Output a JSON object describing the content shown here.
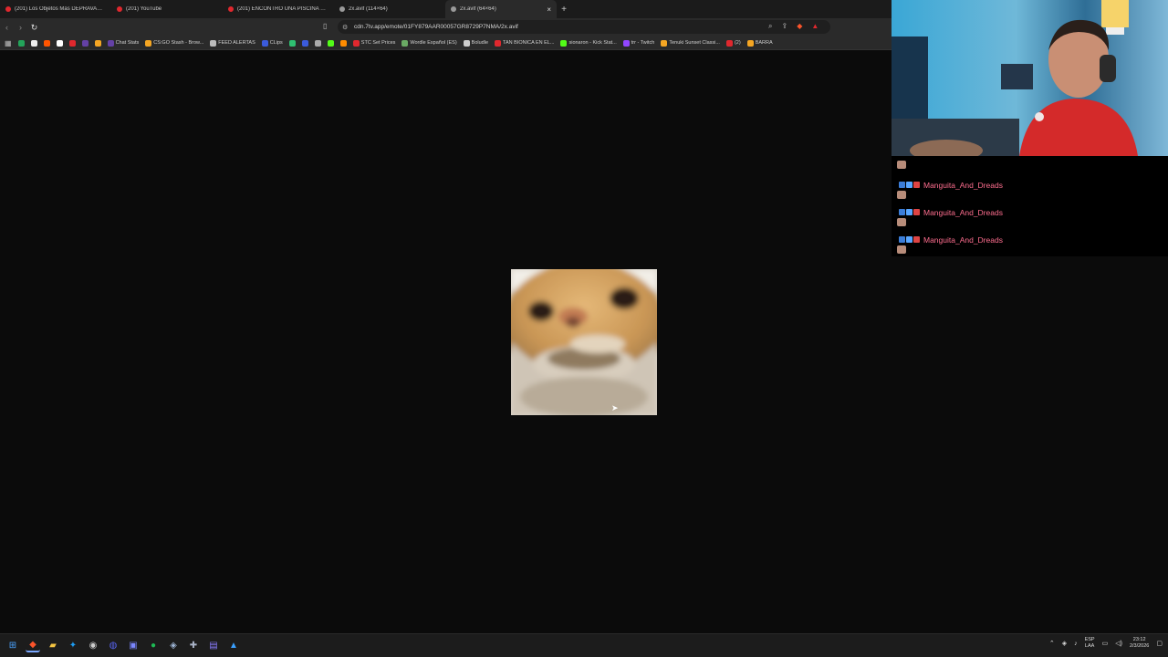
{
  "tabs": [
    {
      "label": "(201) Los Objetos Más DEPRAVADOS",
      "color": "#e0282e",
      "active": false
    },
    {
      "label": "(201) YouTube",
      "color": "#e0282e",
      "active": false
    },
    {
      "label": "(201) ENCONTRÓ UNA PISCINA CON",
      "color": "#e0282e",
      "active": false
    },
    {
      "label": "2x.avif (114×64)",
      "color": "#9a9a9a",
      "active": false
    },
    {
      "label": "2x.avif (64×64)",
      "color": "#9a9a9a",
      "active": true
    }
  ],
  "tab_close_glyph": "×",
  "new_tab_glyph": "+",
  "nav": {
    "back": "‹",
    "forward": "›",
    "reload": "↻"
  },
  "address_bar": {
    "url": "cdn.7tv.app/emote/01FY879AAR00057GR8729P7NMA/2x.avif"
  },
  "bookmarks": [
    {
      "label": "",
      "color": "#23a35a"
    },
    {
      "label": "",
      "color": "#eeeeee"
    },
    {
      "label": "",
      "color": "#ff5500"
    },
    {
      "label": "",
      "color": "#ffffff"
    },
    {
      "label": "",
      "color": "#e0282e"
    },
    {
      "label": "",
      "color": "#6441a5"
    },
    {
      "label": "",
      "color": "#f5a623"
    },
    {
      "label": "Chat Stats",
      "color": "#6441a5"
    },
    {
      "label": "CS:GO Stash - Brow...",
      "color": "#f5a623"
    },
    {
      "label": "FEED ALERTAS",
      "color": "#bbbbbb"
    },
    {
      "label": "CLips",
      "color": "#3b5bdb"
    },
    {
      "label": "",
      "color": "#2fbf71"
    },
    {
      "label": "",
      "color": "#3b5bdb"
    },
    {
      "label": "",
      "color": "#aaaaaa"
    },
    {
      "label": "",
      "color": "#53fc18"
    },
    {
      "label": "",
      "color": "#ff8c00"
    },
    {
      "label": "STC Set Prices",
      "color": "#e0282e"
    },
    {
      "label": "Wordle Español (ES)",
      "color": "#6aaa64"
    },
    {
      "label": "Boludle",
      "color": "#cccccc"
    },
    {
      "label": "TAN BIONICA EN EL...",
      "color": "#e0282e"
    },
    {
      "label": "sionaron - Kick Stat...",
      "color": "#53fc18"
    },
    {
      "label": "trr - Twitch",
      "color": "#9146ff"
    },
    {
      "label": "Tenuki Sunset Classi...",
      "color": "#f5a623"
    },
    {
      "label": "(2)",
      "color": "#e0282e"
    },
    {
      "label": "BARRA",
      "color": "#f5a623"
    }
  ],
  "chat": {
    "messages": [
      {
        "username": "Manguita_And_Dreads"
      },
      {
        "username": "Manguita_And_Dreads"
      },
      {
        "username": "Manguita_And_Dreads"
      }
    ]
  },
  "taskbar": {
    "apps": [
      {
        "name": "windows-start-icon",
        "glyph": "⊞",
        "color": "#4aa3ff"
      },
      {
        "name": "brave-icon",
        "glyph": "◆",
        "color": "#fb542b",
        "active": true
      },
      {
        "name": "file-explorer-icon",
        "glyph": "▰",
        "color": "#f4c542"
      },
      {
        "name": "twitter-icon",
        "glyph": "✦",
        "color": "#1d9bf0"
      },
      {
        "name": "obs-icon",
        "glyph": "◉",
        "color": "#cccccc"
      },
      {
        "name": "discord-icon",
        "glyph": "◍",
        "color": "#5865f2"
      },
      {
        "name": "chat-app-icon",
        "glyph": "▣",
        "color": "#7a86ff"
      },
      {
        "name": "spotify-icon",
        "glyph": "●",
        "color": "#1db954"
      },
      {
        "name": "steam-icon",
        "glyph": "◈",
        "color": "#9fb6d6"
      },
      {
        "name": "controller-icon",
        "glyph": "✚",
        "color": "#aab4c8"
      },
      {
        "name": "app-icon",
        "glyph": "▤",
        "color": "#8a7dff"
      },
      {
        "name": "paint-icon",
        "glyph": "▲",
        "color": "#3aa0ff"
      }
    ],
    "lang": "ESP",
    "lang_sub": "LAA",
    "time": "23:12",
    "date": "2/3/2026"
  }
}
